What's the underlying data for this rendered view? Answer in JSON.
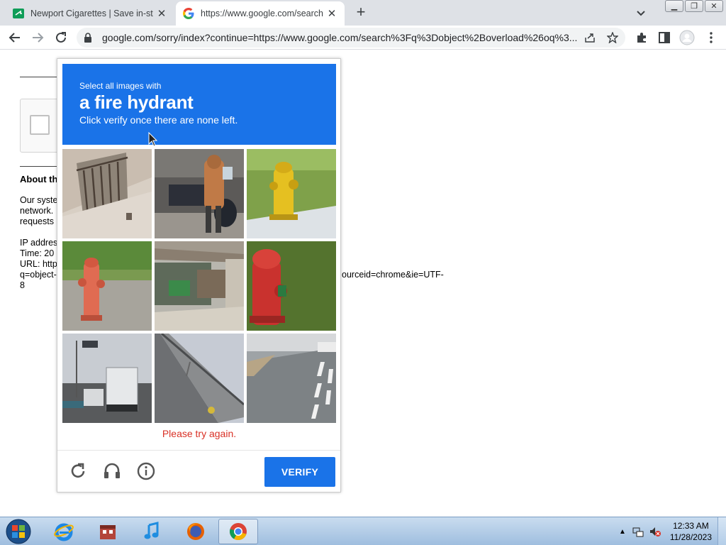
{
  "browser": {
    "tabs": [
      {
        "title": "Newport Cigarettes | Save in-stor",
        "favicon": "newport-favicon",
        "active": false
      },
      {
        "title": "https://www.google.com/search?",
        "favicon": "google-favicon",
        "active": true
      }
    ],
    "address_bar": {
      "url": "google.com/sorry/index?continue=https://www.google.com/search%3Fq%3Dobject%2Boverload%26oq%3..."
    }
  },
  "page": {
    "heading": "About th",
    "paragraph_lines": [
      "Our syste",
      "network.",
      "requests"
    ],
    "info_lines": [
      "IP addres",
      "Time: 20",
      "URL: http",
      "q=object-",
      "8"
    ],
    "url_tail": "ourceid=chrome&ie=UTF-"
  },
  "captcha": {
    "instruction_line1": "Select all images with",
    "target_object": "a fire hydrant",
    "instruction_line3": "Click verify once there are none left.",
    "error_message": "Please try again.",
    "verify_label": "VERIFY",
    "header_color": "#1a73e8",
    "error_color": "#d93025",
    "tiles": [
      "building-balcony",
      "person-with-motorcycle",
      "yellow-fire-hydrant",
      "red-fire-hydrant-grass",
      "market-stall",
      "red-fire-hydrant-close",
      "truck-on-road",
      "highway-overpass",
      "street-crosswalk"
    ]
  },
  "taskbar": {
    "apps": [
      "internet-explorer-icon",
      "store-icon",
      "itunes-icon",
      "firefox-icon",
      "chrome-icon"
    ],
    "clock_time": "12:33 AM",
    "clock_date": "11/28/2023"
  }
}
